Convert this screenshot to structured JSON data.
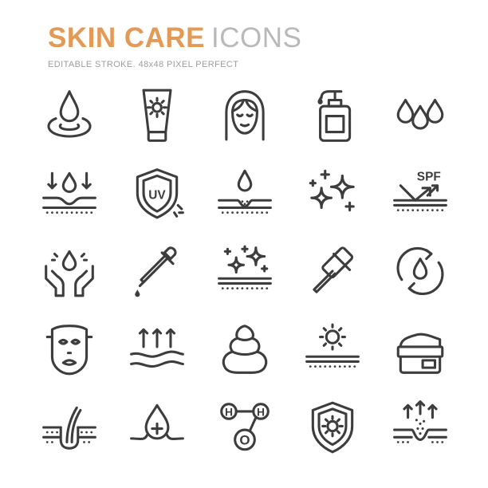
{
  "header": {
    "title_strong": "SKIN CARE",
    "title_light": "ICONS",
    "subtitle": "EDITABLE STROKE. 48x48 PIXEL PERFECT"
  },
  "icon_labels": {
    "uv": "UV",
    "spf": "SPF",
    "h": "H",
    "o": "O"
  },
  "icons": [
    "water-drop-ripple-icon",
    "sunscreen-tube-icon",
    "woman-face-icon",
    "pump-bottle-icon",
    "three-drops-icon",
    "skin-moisture-absorption-icon",
    "uv-shield-icon",
    "drop-on-skin-pore-icon",
    "sparkles-icon",
    "spf-skin-protection-icon",
    "drop-in-hands-icon",
    "dropper-pipette-icon",
    "sparkling-skin-icon",
    "razor-icon",
    "refresh-drop-icon",
    "face-mask-icon",
    "skin-upward-arrows-icon",
    "cream-swirl-icon",
    "sun-over-skin-icon",
    "cream-jar-icon",
    "hair-follicle-icon",
    "drop-plus-on-skin-icon",
    "water-molecule-icon",
    "sun-shield-icon",
    "pore-cleansing-icon"
  ]
}
